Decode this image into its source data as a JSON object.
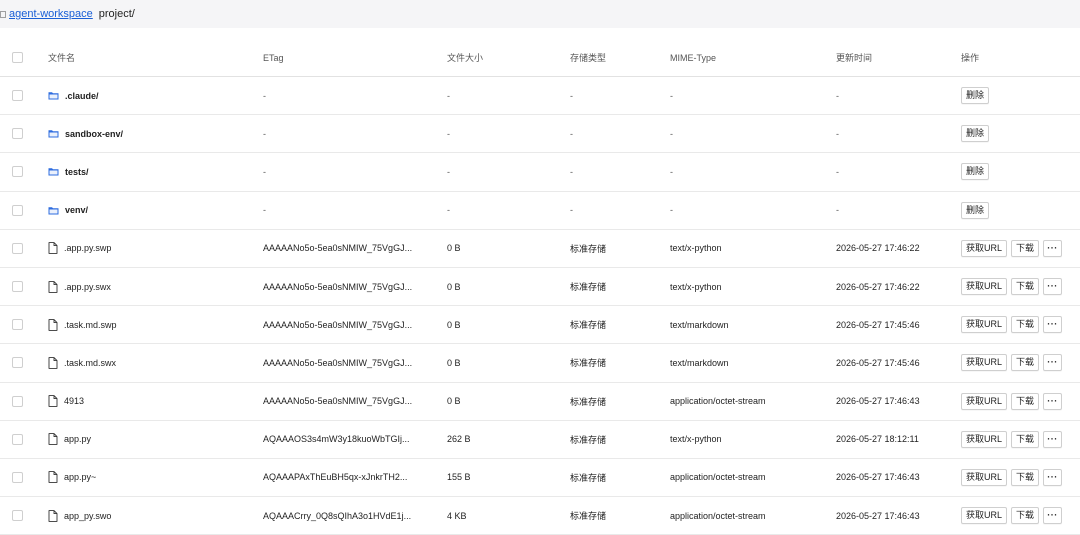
{
  "breadcrumb": {
    "root_label": "agent-workspace",
    "current_label": "project/"
  },
  "table": {
    "headers": {
      "name": "文件名",
      "etag": "ETag",
      "size": "文件大小",
      "storage_type": "存储类型",
      "mime": "MIME-Type",
      "updated": "更新时间",
      "actions": "操作"
    },
    "labels": {
      "delete": "删除",
      "get_url": "获取URL",
      "download": "下载",
      "more": "···"
    },
    "folders": [
      {
        "name": ".claude/",
        "etag": "-",
        "size": "-",
        "storage_type": "-",
        "mime": "-",
        "updated": "-"
      },
      {
        "name": "sandbox-env/",
        "etag": "-",
        "size": "-",
        "storage_type": "-",
        "mime": "-",
        "updated": "-"
      },
      {
        "name": "tests/",
        "etag": "-",
        "size": "-",
        "storage_type": "-",
        "mime": "-",
        "updated": "-"
      },
      {
        "name": "venv/",
        "etag": "-",
        "size": "-",
        "storage_type": "-",
        "mime": "-",
        "updated": "-"
      }
    ],
    "files": [
      {
        "name": ".app.py.swp",
        "etag": "AAAAANo5o-5ea0sNMIW_75VgGJ...",
        "size": "0 B",
        "storage_type": "标准存储",
        "mime": "text/x-python",
        "updated": "2026-05-27 17:46:22"
      },
      {
        "name": ".app.py.swx",
        "etag": "AAAAANo5o-5ea0sNMIW_75VgGJ...",
        "size": "0 B",
        "storage_type": "标准存储",
        "mime": "text/x-python",
        "updated": "2026-05-27 17:46:22"
      },
      {
        "name": ".task.md.swp",
        "etag": "AAAAANo5o-5ea0sNMIW_75VgGJ...",
        "size": "0 B",
        "storage_type": "标准存储",
        "mime": "text/markdown",
        "updated": "2026-05-27 17:45:46"
      },
      {
        "name": ".task.md.swx",
        "etag": "AAAAANo5o-5ea0sNMIW_75VgGJ...",
        "size": "0 B",
        "storage_type": "标准存储",
        "mime": "text/markdown",
        "updated": "2026-05-27 17:45:46"
      },
      {
        "name": "4913",
        "etag": "AAAAANo5o-5ea0sNMIW_75VgGJ...",
        "size": "0 B",
        "storage_type": "标准存储",
        "mime": "application/octet-stream",
        "updated": "2026-05-27 17:46:43"
      },
      {
        "name": "app.py",
        "etag": "AQAAAOS3s4mW3y18kuoWbTGIj...",
        "size": "262 B",
        "storage_type": "标准存储",
        "mime": "text/x-python",
        "updated": "2026-05-27 18:12:11"
      },
      {
        "name": "app.py~",
        "etag": "AQAAAPAxThEuBH5qx-xJnkrTH2...",
        "size": "155 B",
        "storage_type": "标准存储",
        "mime": "application/octet-stream",
        "updated": "2026-05-27 17:46:43"
      },
      {
        "name": "app_py.swo",
        "etag": "AQAAACrry_0Q8sQIhA3o1HVdE1j...",
        "size": "4 KB",
        "storage_type": "标准存储",
        "mime": "application/octet-stream",
        "updated": "2026-05-27 17:46:43"
      }
    ]
  },
  "colors": {
    "link": "#1a5fd6",
    "folder_icon": "#2d6cdf"
  },
  "icons": {
    "folder": "folder-icon",
    "file": "file-icon",
    "breadcrumb": "folder-outline-icon"
  }
}
